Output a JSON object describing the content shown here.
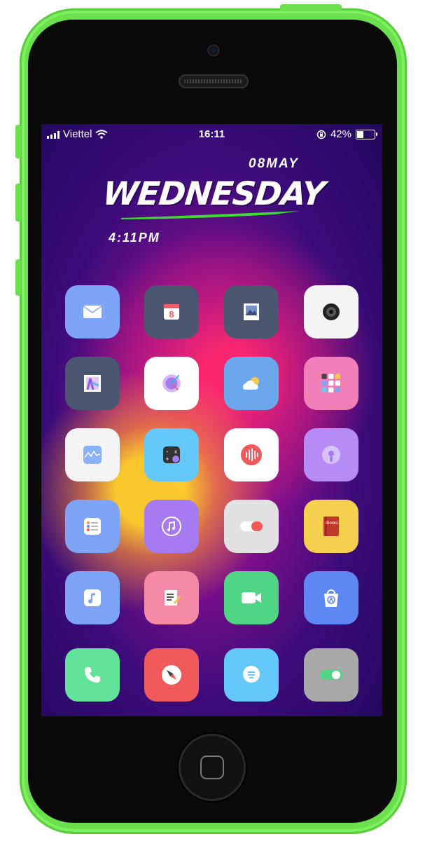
{
  "status_bar": {
    "carrier": "Viettel",
    "time": "16:11",
    "battery_percent": "42%",
    "battery_level": 0.42
  },
  "widget": {
    "date": "08MAY",
    "day": "WEDNESDAY",
    "time": "4:11PM",
    "accent_color": "#3ddc2f"
  },
  "apps": [
    {
      "icon": "mail-icon",
      "color": "#7da4f7"
    },
    {
      "icon": "calendar-icon",
      "color": "#4b5670",
      "text": "8"
    },
    {
      "icon": "photos-icon",
      "color": "#4b5670"
    },
    {
      "icon": "camera-icon",
      "color": "#f4f4f4"
    },
    {
      "icon": "maps-icon",
      "color": "#4b5670"
    },
    {
      "icon": "clock-icon",
      "color": "#ffffff"
    },
    {
      "icon": "weather-icon",
      "color": "#6aa7ec"
    },
    {
      "icon": "app-folder-icon",
      "color": "#f07fb8"
    },
    {
      "icon": "stocks-icon",
      "color": "#f4f4f4"
    },
    {
      "icon": "calculator-icon",
      "color": "#64c8f8"
    },
    {
      "icon": "voice-memos-icon",
      "color": "#ffffff"
    },
    {
      "icon": "podcasts-icon",
      "color": "#b58cf5"
    },
    {
      "icon": "reminders-icon",
      "color": "#7da4f7"
    },
    {
      "icon": "itunes-store-icon",
      "color": "#a67af1"
    },
    {
      "icon": "settings-toggle-icon",
      "color": "#e2e2e2"
    },
    {
      "icon": "ibooks-icon",
      "color": "#f5cf4e",
      "text": "iBooks"
    },
    {
      "icon": "music-icon",
      "color": "#7da4f7"
    },
    {
      "icon": "notes-icon",
      "color": "#f48aa6"
    },
    {
      "icon": "facetime-icon",
      "color": "#4fd584"
    },
    {
      "icon": "app-store-icon",
      "color": "#5f87f3"
    },
    {
      "icon": "phone-icon",
      "color": "#63e29a"
    },
    {
      "icon": "safari-icon",
      "color": "#f05a5a"
    },
    {
      "icon": "messages-icon",
      "color": "#64c8f8"
    },
    {
      "icon": "toggle-icon",
      "color": "#a9a9a9"
    }
  ]
}
